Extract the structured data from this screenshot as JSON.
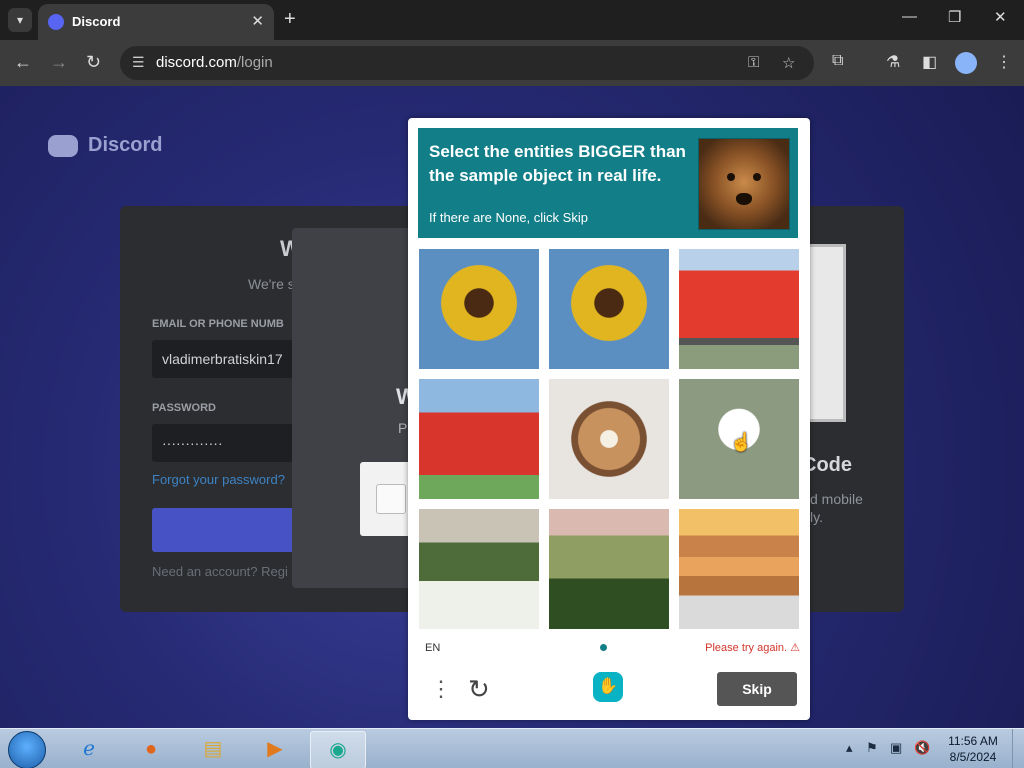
{
  "browser": {
    "tab_title": "Discord",
    "url_host": "discord.com",
    "url_path": "/login"
  },
  "discord": {
    "logo_text": "Discord",
    "welcome_title": "W",
    "welcome_sub": "We're s",
    "email_label": "EMAIL OR PHONE NUMB",
    "email_value": "vladimerbratiskin17",
    "password_label": "PASSWORD",
    "password_value": "·············",
    "forgot_link": "Forgot your password?",
    "need_account": "Need an account? Regi",
    "qr_title": "Code",
    "qr_sub_line1": "d mobile",
    "qr_sub_line2": "ly.",
    "overlay_title": "W",
    "overlay_sub": "P"
  },
  "captcha": {
    "prompt": "Select the entities BIGGER than the sample object in real life.",
    "hint": "If there are None, click Skip",
    "language": "EN",
    "error": "Please try again. ⚠",
    "skip_label": "Skip",
    "tiles": [
      "sunflower",
      "sunflower",
      "bus",
      "bus",
      "pancake",
      "daisy-pot",
      "daisy-field",
      "daisy-field",
      "pancake-stack"
    ]
  },
  "taskbar": {
    "time": "11:56 AM",
    "date": "8/5/2024"
  },
  "colors": {
    "captcha_accent": "#127f88",
    "discord_blurple": "#5865f2",
    "error_red": "#d1372c"
  }
}
